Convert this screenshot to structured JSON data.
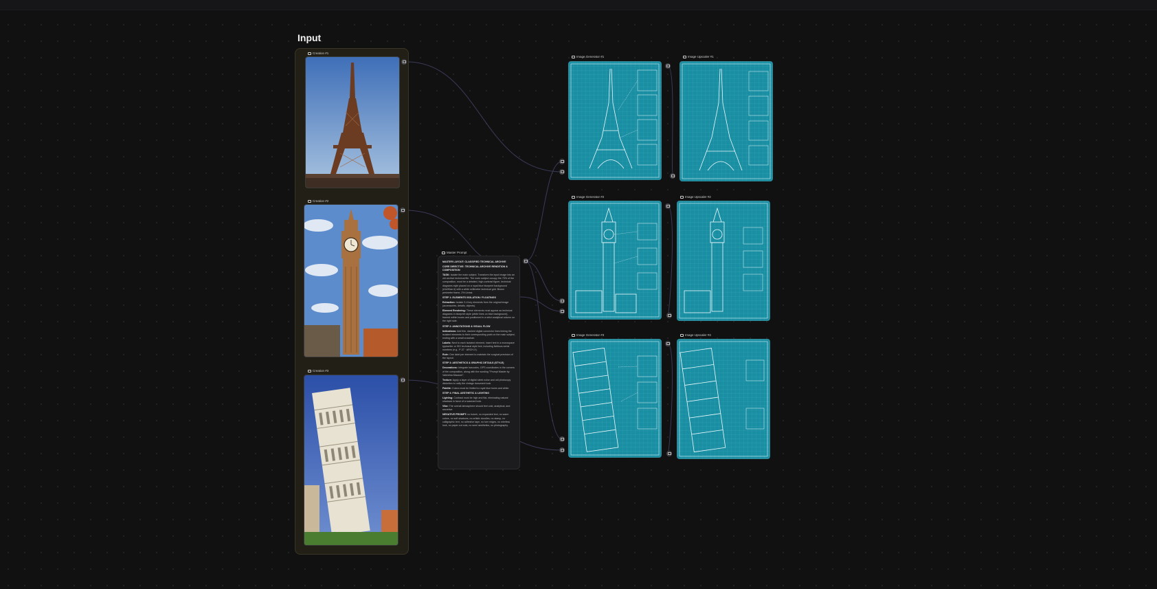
{
  "group": {
    "title": "Input"
  },
  "inputs": [
    {
      "label": "Creation #1",
      "subject": "eiffel-tower"
    },
    {
      "label": "Creation #2",
      "subject": "big-ben"
    },
    {
      "label": "Creation #3",
      "subject": "leaning-tower-of-pisa"
    }
  ],
  "prompt_node": {
    "label": "Master Prompt",
    "paragraphs": [
      {
        "head": "MASTER LAYOUT: CLASSIFIED TECHNICAL ARCHIVE",
        "body": ""
      },
      {
        "head": "CORE DIRECTIVE: TECHNICAL ARCHIVE RENDITION & COMPOSITION",
        "body": ""
      },
      {
        "head": "TASK:",
        "body": "Isolate the main subject. Transform the input image into an old archive technical file. The main subject occupy the 70% of the composition, must be a detailed, high-contrast figure, technical diagrams style placed on a royal blue blueprint background (#1e90ae #) with a white millimeter technical grid. Brown perimeter frame, 2% Linear."
      },
      {
        "head": "STEP 1: ELEMENTS ISOLATION / FLOATINGS",
        "body": ""
      },
      {
        "head": "Extraction:",
        "body": "Isolate 3-4 key elements from the original image (accessories, details, objects)."
      },
      {
        "head": "Element Rendering:",
        "body": "These elements must appear as technical diagrams in blueprint style (white lines on blue background), framed within boxes and positioned in a strict analytical column on the right side."
      },
      {
        "head": "STEP 2: ANNOTATIONS & VISUAL FLOW",
        "body": ""
      },
      {
        "head": "Indications:",
        "body": "Add thin, dashed digital connector lines linking the isolated elements to their corresponding point on the main subject, ending with a small crosshair."
      },
      {
        "head": "Labels:",
        "body": "Next to each isolated element, insert text in a monospace typewriter or ISO technical style font, including fictitious serial numbers (e.g., P-37 · ARCH-X)."
      },
      {
        "head": "Rule:",
        "body": "One label per element to maintain the surgical precision of the layout."
      },
      {
        "head": "STEP 3: AESTHETICS & GRAPHIC DETAILS (STYLE)",
        "body": ""
      },
      {
        "head": "Decorations:",
        "body": "Integrate barcodes, GPS coordinates in the corners of the composition, along with the wording \"Prompt Master by Valentina Mazzoni\"."
      },
      {
        "head": "Texture:",
        "body": "Apply a layer of digital sleek noise and old photocopy distortion to unify the vintage document look."
      },
      {
        "head": "Palette:",
        "body": "Colors must be limited to royal blue tones and white."
      },
      {
        "head": "STEP 4: FINAL AESTHETIC & LIGHTING",
        "body": ""
      },
      {
        "head": "Lighting:",
        "body": "Contrast must be high and flat, eliminating natural shadows in favor of a scanned look."
      },
      {
        "head": "Vibe:",
        "body": "The overall atmosphere should feel cold, analytical, and secretive."
      },
      {
        "head": "NEGATIVE PROMPT:",
        "body": "no bokeh, no expanded text, no warm colors, no soft shadows, no artistic doodles, no stamp, no calligraphic text, no adhesive tape, no torn edges, no wireless look, no paper cut outs, no sumi aesthetics, no photography."
      }
    ]
  },
  "generators": [
    {
      "label": "Image Generator #1",
      "subject": "eiffel-tower"
    },
    {
      "label": "Image Generator #2",
      "subject": "big-ben"
    },
    {
      "label": "Image Generator #3",
      "subject": "leaning-tower-of-pisa"
    }
  ],
  "upscalers": [
    {
      "label": "Image Upscaler #1",
      "subject": "eiffel-tower"
    },
    {
      "label": "Image Upscaler #2",
      "subject": "big-ben"
    },
    {
      "label": "Image Upscaler #3",
      "subject": "leaning-tower-of-pisa"
    }
  ],
  "colors": {
    "blueprint": "#1a8ea3",
    "group_bg": "#221f17",
    "canvas": "#111112",
    "wire": "#3d3d5a"
  },
  "icons": [
    "image-node-icon",
    "text-node-icon",
    "output-port-icon",
    "input-port-icon"
  ]
}
